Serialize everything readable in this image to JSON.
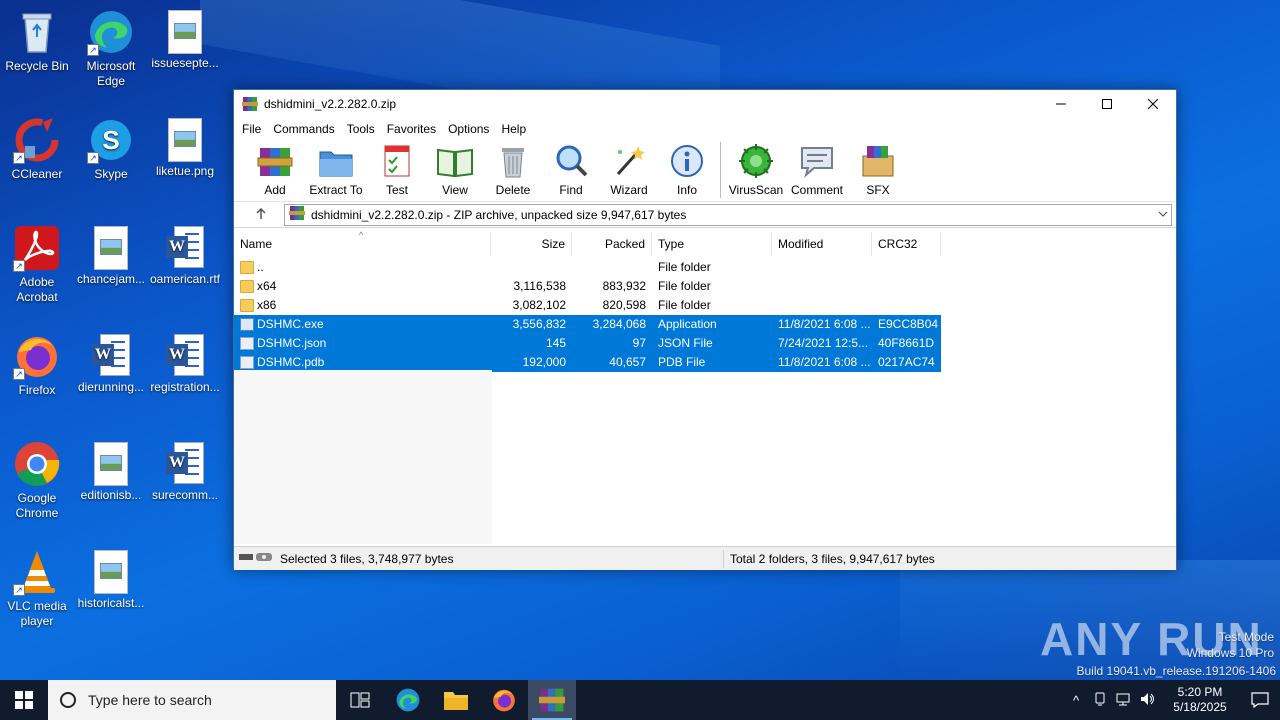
{
  "desktop": {
    "icons": [
      {
        "label": "Recycle Bin"
      },
      {
        "label": "Microsoft Edge"
      },
      {
        "label": "issuesepte..."
      },
      {
        "label": "CCleaner"
      },
      {
        "label": "Skype"
      },
      {
        "label": "liketue.png"
      },
      {
        "label": "Adobe Acrobat"
      },
      {
        "label": "chancejam..."
      },
      {
        "label": "oamerican.rtf"
      },
      {
        "label": "Firefox"
      },
      {
        "label": "dierunning..."
      },
      {
        "label": "registration..."
      },
      {
        "label": "Google Chrome"
      },
      {
        "label": "editionisb..."
      },
      {
        "label": "surecomm..."
      },
      {
        "label": "VLC media player"
      },
      {
        "label": "historicalst..."
      }
    ]
  },
  "window": {
    "title": "dshidmini_v2.2.282.0.zip",
    "menu": [
      "File",
      "Commands",
      "Tools",
      "Favorites",
      "Options",
      "Help"
    ],
    "toolbar": [
      {
        "label": "Add",
        "icon": "add-archive-icon"
      },
      {
        "label": "Extract To",
        "icon": "extract-folder-icon"
      },
      {
        "label": "Test",
        "icon": "test-checklist-icon"
      },
      {
        "label": "View",
        "icon": "view-book-icon"
      },
      {
        "label": "Delete",
        "icon": "trash-icon"
      },
      {
        "label": "Find",
        "icon": "magnifier-icon"
      },
      {
        "label": "Wizard",
        "icon": "wand-icon"
      },
      {
        "label": "Info",
        "icon": "info-icon"
      },
      {
        "label": "VirusScan",
        "icon": "virus-icon"
      },
      {
        "label": "Comment",
        "icon": "comment-icon"
      },
      {
        "label": "SFX",
        "icon": "sfx-box-icon"
      }
    ],
    "address": "dshidmini_v2.2.282.0.zip - ZIP archive, unpacked size 9,947,617 bytes",
    "columns": [
      "Name",
      "Size",
      "Packed",
      "Type",
      "Modified",
      "CRC32"
    ],
    "rows": [
      {
        "name": "..",
        "size": "",
        "packed": "",
        "type": "File folder",
        "modified": "",
        "crc": "",
        "kind": "folder",
        "selected": false
      },
      {
        "name": "x64",
        "size": "3,116,538",
        "packed": "883,932",
        "type": "File folder",
        "modified": "",
        "crc": "",
        "kind": "folder",
        "selected": false
      },
      {
        "name": "x86",
        "size": "3,082,102",
        "packed": "820,598",
        "type": "File folder",
        "modified": "",
        "crc": "",
        "kind": "folder",
        "selected": false
      },
      {
        "name": "DSHMC.exe",
        "size": "3,556,832",
        "packed": "3,284,068",
        "type": "Application",
        "modified": "11/8/2021 6:08 ...",
        "crc": "E9CC8B04",
        "kind": "exe",
        "selected": true
      },
      {
        "name": "DSHMC.json",
        "size": "145",
        "packed": "97",
        "type": "JSON File",
        "modified": "7/24/2021 12:5...",
        "crc": "40F8661D",
        "kind": "doc",
        "selected": true
      },
      {
        "name": "DSHMC.pdb",
        "size": "192,000",
        "packed": "40,657",
        "type": "PDB File",
        "modified": "11/8/2021 6:08 ...",
        "crc": "0217AC74",
        "kind": "doc",
        "selected": true
      }
    ],
    "status_left": "Selected 3 files, 3,748,977 bytes",
    "status_right": "Total 2 folders, 3 files, 9,947,617 bytes"
  },
  "watermark": {
    "brand": "ANY RUN",
    "line1": "Test Mode",
    "line2": "Windows 10 Pro",
    "line3": "Build 19041.vb_release.191206-1406"
  },
  "taskbar": {
    "search_placeholder": "Type here to search",
    "time": "5:20 PM",
    "date": "5/18/2025"
  },
  "colors": {
    "selection": "#0078d7",
    "taskbar": "#101c2e"
  }
}
